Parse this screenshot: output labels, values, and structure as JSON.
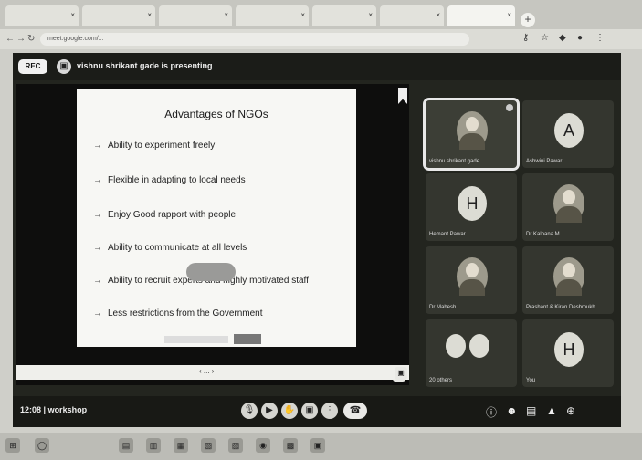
{
  "browser": {
    "tabs": [
      {
        "label": "..."
      },
      {
        "label": "..."
      },
      {
        "label": "..."
      },
      {
        "label": "..."
      },
      {
        "label": "..."
      },
      {
        "label": "..."
      },
      {
        "label": "..."
      }
    ],
    "new_tab_icon": "plus-icon",
    "url": "meet.google.com/..."
  },
  "meet": {
    "rec_label": "REC",
    "presenting_text": "vishnu shrikant gade is presenting",
    "slide": {
      "title": "Advantages of NGOs",
      "bullets": [
        "Ability to experiment freely",
        "Flexible in adapting to local needs",
        "Enjoy Good rapport with people",
        "Ability to communicate at all levels",
        "Ability to recruit experts and highly motivated staff",
        "Less restrictions from the Government"
      ],
      "arrow": "→"
    },
    "viewer": {
      "page": "‹ ... ›"
    },
    "participants": [
      {
        "name": "vishnu shrikant gade",
        "avatar": "",
        "type": "photo"
      },
      {
        "name": "Ashwini Pawar",
        "avatar": "A",
        "type": "letter"
      },
      {
        "name": "Hemant Pawar",
        "avatar": "H",
        "type": "letter"
      },
      {
        "name": "Dr Kalpana M...",
        "avatar": "",
        "type": "photo"
      },
      {
        "name": "Dr Mahesh ...",
        "avatar": "",
        "type": "photo"
      },
      {
        "name": "Prashant & Kiran Deshmukh",
        "avatar": "",
        "type": "photo"
      },
      {
        "name": "20 others",
        "avatar": "",
        "type": "group"
      },
      {
        "name": "You",
        "avatar": "H",
        "type": "letter"
      }
    ],
    "clock": "12:08",
    "meeting_name": "workshop",
    "controls": [
      "mic-icon",
      "camera-icon",
      "hand-icon",
      "present-icon",
      "more-icon",
      "end-call-icon"
    ],
    "right_controls": [
      "info-icon",
      "people-icon",
      "chat-icon",
      "activities-icon",
      "lock-icon"
    ]
  }
}
